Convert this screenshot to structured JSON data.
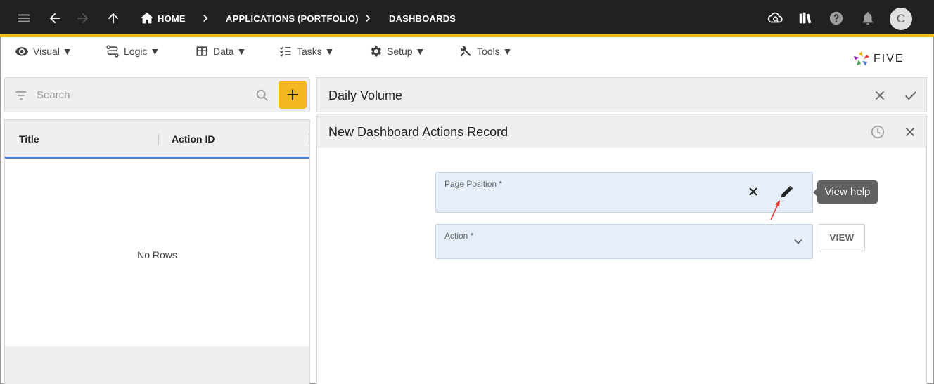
{
  "topbar": {
    "breadcrumbs": [
      "HOME",
      "APPLICATIONS (PORTFOLIO)",
      "DASHBOARDS"
    ],
    "avatar_initial": "C",
    "icons": [
      "menu-icon",
      "back-arrow-icon",
      "forward-arrow-icon",
      "up-arrow-icon",
      "home-icon",
      "cloud-sync-icon",
      "library-icon",
      "help-icon",
      "bell-icon"
    ]
  },
  "menubar": {
    "items": [
      {
        "label": "Visual ▼",
        "icon": "eye-icon"
      },
      {
        "label": "Logic ▼",
        "icon": "logic-icon"
      },
      {
        "label": "Data ▼",
        "icon": "table-icon"
      },
      {
        "label": "Tasks ▼",
        "icon": "tasks-icon"
      },
      {
        "label": "Setup ▼",
        "icon": "gear-icon"
      },
      {
        "label": "Tools ▼",
        "icon": "tools-icon"
      }
    ],
    "logo_text": "FIVE"
  },
  "left": {
    "search_placeholder": "Search",
    "columns": [
      "Title",
      "Action ID"
    ],
    "empty_text": "No Rows"
  },
  "right": {
    "parent_title": "Daily Volume",
    "form_title": "New Dashboard Actions Record",
    "fields": {
      "page_position": {
        "label": "Page Position *",
        "value": ""
      },
      "action": {
        "label": "Action *",
        "value": ""
      }
    },
    "tooltip": "View help",
    "view_button": "VIEW"
  },
  "colors": {
    "topbar": "#212121",
    "accent": "#f3b81f",
    "field_bg": "#e6eff9",
    "grid_underline": "#4a7fd4",
    "annotation_arrow": "#e53935"
  }
}
